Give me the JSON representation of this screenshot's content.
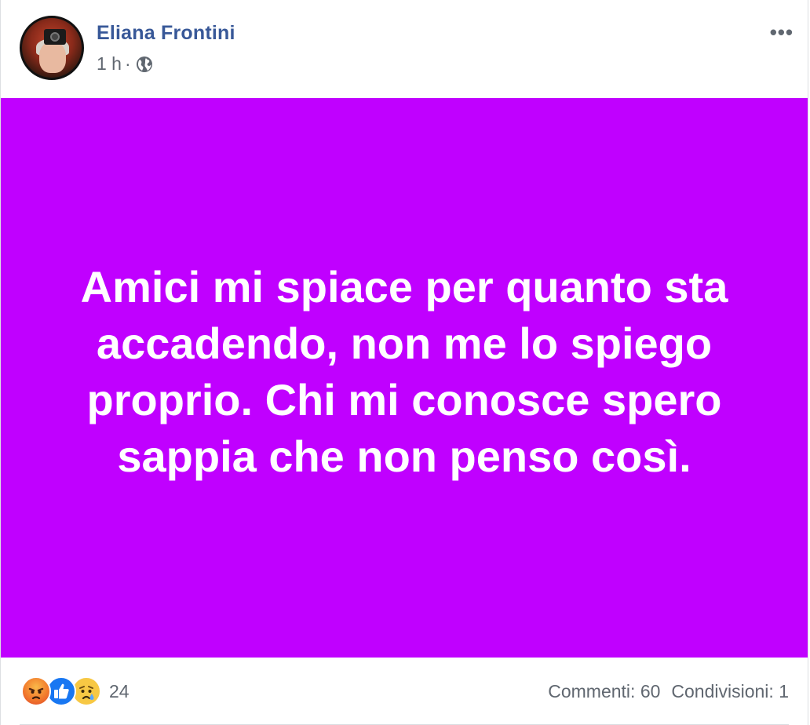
{
  "post": {
    "author": "Eliana Frontini",
    "time": "1 h",
    "separator": "·",
    "privacy_icon": "globe-icon",
    "more_icon": "ellipsis-icon",
    "more_label": "•••",
    "background_color": "#c000ff",
    "text": "Amici mi spiace per quanto sta accadendo, non me lo spiego proprio. Chi mi conosce spero sappia che non penso così."
  },
  "footer": {
    "reactions": [
      "angry-reaction-icon",
      "like-reaction-icon",
      "sad-reaction-icon"
    ],
    "reaction_count": "24",
    "comments": "Commenti: 60",
    "shares": "Condivisioni: 1"
  },
  "colors": {
    "author_link": "#385898",
    "meta_text": "#606770",
    "like_blue": "#1877f2"
  }
}
